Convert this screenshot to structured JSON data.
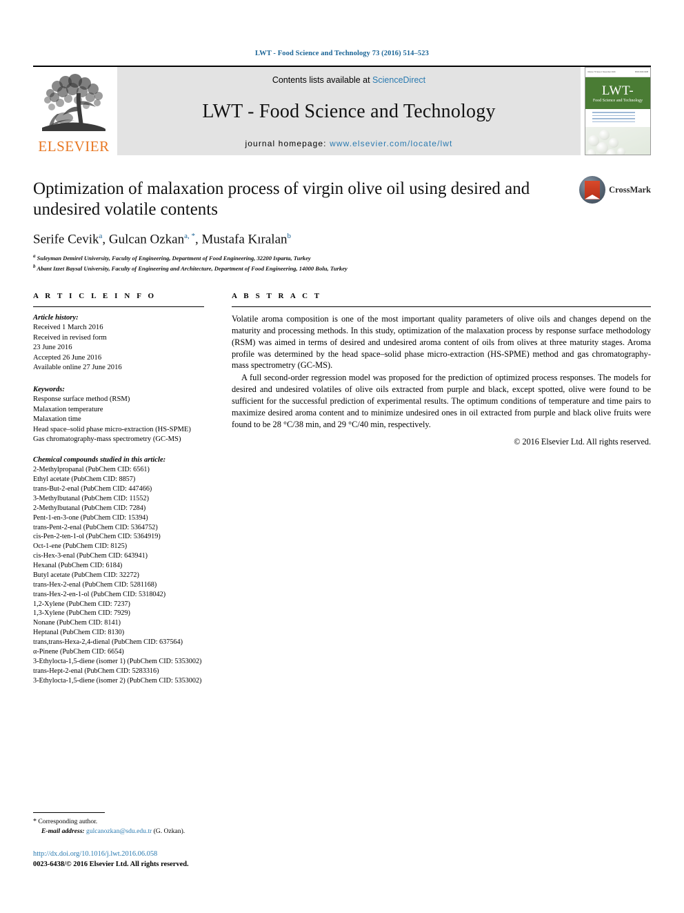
{
  "running_head": "LWT - Food Science and Technology 73 (2016) 514–523",
  "journal_header": {
    "contents_prefix": "Contents lists available at ",
    "sciencedirect": "ScienceDirect",
    "journal_title": "LWT - Food Science and Technology",
    "homepage_label": "journal homepage: ",
    "homepage_url": "www.elsevier.com/locate/lwt",
    "publisher": "ELSEVIER",
    "cover": {
      "title": "LWT-",
      "subtitle": "Food Science and Technology",
      "top_left": "Volume 73 Issue 1 November 2016",
      "top_right": "ISSN 0023-6438"
    },
    "accent_link_color": "#2a7ab0",
    "elsevier_orange": "#E87722",
    "cover_green": "#4a7c34"
  },
  "crossmark": {
    "label": "CrossMark"
  },
  "article": {
    "title": "Optimization of malaxation process of virgin olive oil using desired and undesired volatile contents",
    "authors": [
      {
        "name": "Serife Cevik",
        "sup": "a"
      },
      {
        "name": "Gulcan Ozkan",
        "sup": "a, *"
      },
      {
        "name": "Mustafa Kıralan",
        "sup": "b"
      }
    ],
    "authors_line": "Serife Cevik a, Gulcan Ozkan a, *, Mustafa Kıralan b",
    "affiliations": [
      {
        "sup": "a",
        "text": "Suleyman Demirel University, Faculty of Engineering, Department of Food Engineering, 32200 Isparta, Turkey"
      },
      {
        "sup": "b",
        "text": "Abant Izzet Baysal University, Faculty of Engineering and Architecture, Department of Food Engineering, 14000 Bolu, Turkey"
      }
    ]
  },
  "article_info": {
    "heading": "A R T I C L E   I N F O",
    "history_label": "Article history:",
    "history": [
      "Received 1 March 2016",
      "Received in revised form",
      "23 June 2016",
      "Accepted 26 June 2016",
      "Available online 27 June 2016"
    ],
    "keywords_label": "Keywords:",
    "keywords": [
      "Response surface method (RSM)",
      "Malaxation temperature",
      "Malaxation time",
      "Head space–solid phase micro-extraction (HS-SPME)",
      "Gas chromatography-mass spectrometry (GC-MS)"
    ],
    "compounds_label": "Chemical compounds studied in this article:",
    "compounds": [
      "2-Methylpropanal (PubChem CID: 6561)",
      "Ethyl acetate (PubChem CID: 8857)",
      "trans-But-2-enal (PubChem CID: 447466)",
      "3-Methylbutanal (PubChem CID: 11552)",
      "2-Methylbutanal (PubChem CID: 7284)",
      "Pent-1-en-3-one (PubChem CID: 15394)",
      "trans-Pent-2-enal (PubChem CID: 5364752)",
      "cis-Pen-2-ten-1-ol (PubChem CID: 5364919)",
      "Oct-1-ene (PubChem CID: 8125)",
      "cis-Hex-3-enal (PubChem CID: 643941)",
      "Hexanal (PubChem CID: 6184)",
      "Butyl acetate (PubChem CID: 32272)",
      "trans-Hex-2-enal (PubChem CID: 5281168)",
      "trans-Hex-2-en-1-ol (PubChem CID: 5318042)",
      "1,2-Xylene (PubChem CID: 7237)",
      "1,3-Xylene (PubChem CID: 7929)",
      "Nonane (PubChem CID: 8141)",
      "Heptanal (PubChem CID: 8130)",
      "trans,trans-Hexa-2,4-dienal (PubChem CID: 637564)",
      "α-Pinene (PubChem CID: 6654)",
      "3-Ethylocta-1,5-diene (isomer 1) (PubChem CID: 5353002)",
      "trans-Hept-2-enal (PubChem CID: 5283316)",
      "3-Ethylocta-1,5-diene (isomer 2) (PubChem CID: 5353002)"
    ]
  },
  "abstract": {
    "heading": "A B S T R A C T",
    "paragraph_1": "Volatile aroma composition is one of the most important quality parameters of olive oils and changes depend on the maturity and processing methods. In this study, optimization of the malaxation process by response surface methodology (RSM) was aimed in terms of desired and undesired aroma content of oils from olives at three maturity stages. Aroma profile was determined by the head space–solid phase micro-extraction (HS-SPME) method and gas chromatography-mass spectrometry (GC-MS).",
    "paragraph_2": "A full second-order regression model was proposed for the prediction of optimized process responses. The models for desired and undesired volatiles of olive oils extracted from purple and black, except spotted, olive were found to be sufficient for the successful prediction of experimental results. The optimum conditions of temperature and time pairs to maximize desired aroma content and to minimize undesired ones in oil extracted from purple and black olive fruits were found to be 28 °C/38 min, and 29 °C/40 min, respectively.",
    "copyright": "© 2016 Elsevier Ltd. All rights reserved."
  },
  "footer": {
    "corresponding_author": "Corresponding author.",
    "email_label": "E-mail address:",
    "email": "gulcanozkan@sdu.edu.tr",
    "email_owner": "(G. Ozkan).",
    "doi": "http://dx.doi.org/10.1016/j.lwt.2016.06.058",
    "issn_line": "0023-6438/© 2016 Elsevier Ltd. All rights reserved."
  }
}
